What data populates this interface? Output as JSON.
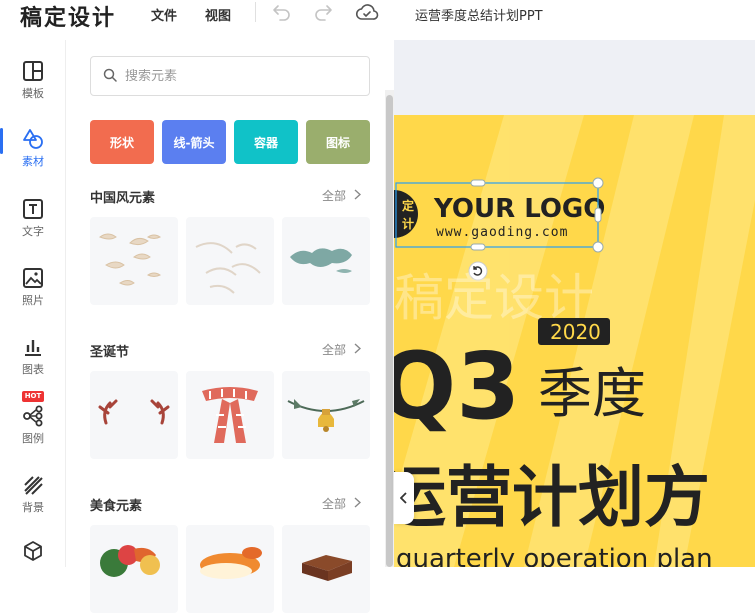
{
  "app": {
    "name": "稿定设计"
  },
  "menu": {
    "file": "文件",
    "view": "视图"
  },
  "toolbar": {
    "undo_icon": "undo-icon",
    "redo_icon": "redo-icon",
    "cloud_icon": "cloud-save-icon"
  },
  "document": {
    "title": "运营季度总结计划PPT"
  },
  "rail": {
    "items": [
      {
        "label": "模板",
        "icon": "template-icon"
      },
      {
        "label": "素材",
        "icon": "shapes-icon",
        "active": true
      },
      {
        "label": "文字",
        "icon": "text-icon"
      },
      {
        "label": "照片",
        "icon": "photo-icon"
      },
      {
        "label": "图表",
        "icon": "chart-icon"
      },
      {
        "label": "图例",
        "icon": "diagram-icon",
        "badge": "HOT"
      },
      {
        "label": "背景",
        "icon": "background-icon"
      },
      {
        "label": "",
        "icon": "cube-icon"
      }
    ],
    "accent": "#2a6ff2"
  },
  "search": {
    "placeholder": "搜索元素"
  },
  "tags": [
    {
      "label": "形状",
      "color": "#f26c4f"
    },
    {
      "label": "线-箭头",
      "color": "#5b7ff0"
    },
    {
      "label": "容器",
      "color": "#10c2c8"
    },
    {
      "label": "图标",
      "color": "#9aae6d"
    }
  ],
  "sections": [
    {
      "title": "中国风元素",
      "more": "全部"
    },
    {
      "title": "圣诞节",
      "more": "全部"
    },
    {
      "title": "美食元素",
      "more": "全部"
    }
  ],
  "poster": {
    "logo_main": "YOUR LOGO",
    "logo_url": "www.gaoding.com",
    "logo_badge_chars": "定计",
    "watermark": "稿定设计",
    "year": "2020",
    "big_q": "Q3",
    "season": "季度",
    "headline": "运营计划方",
    "subline": "quarterly operation plan",
    "bg": "#ffd84a"
  }
}
